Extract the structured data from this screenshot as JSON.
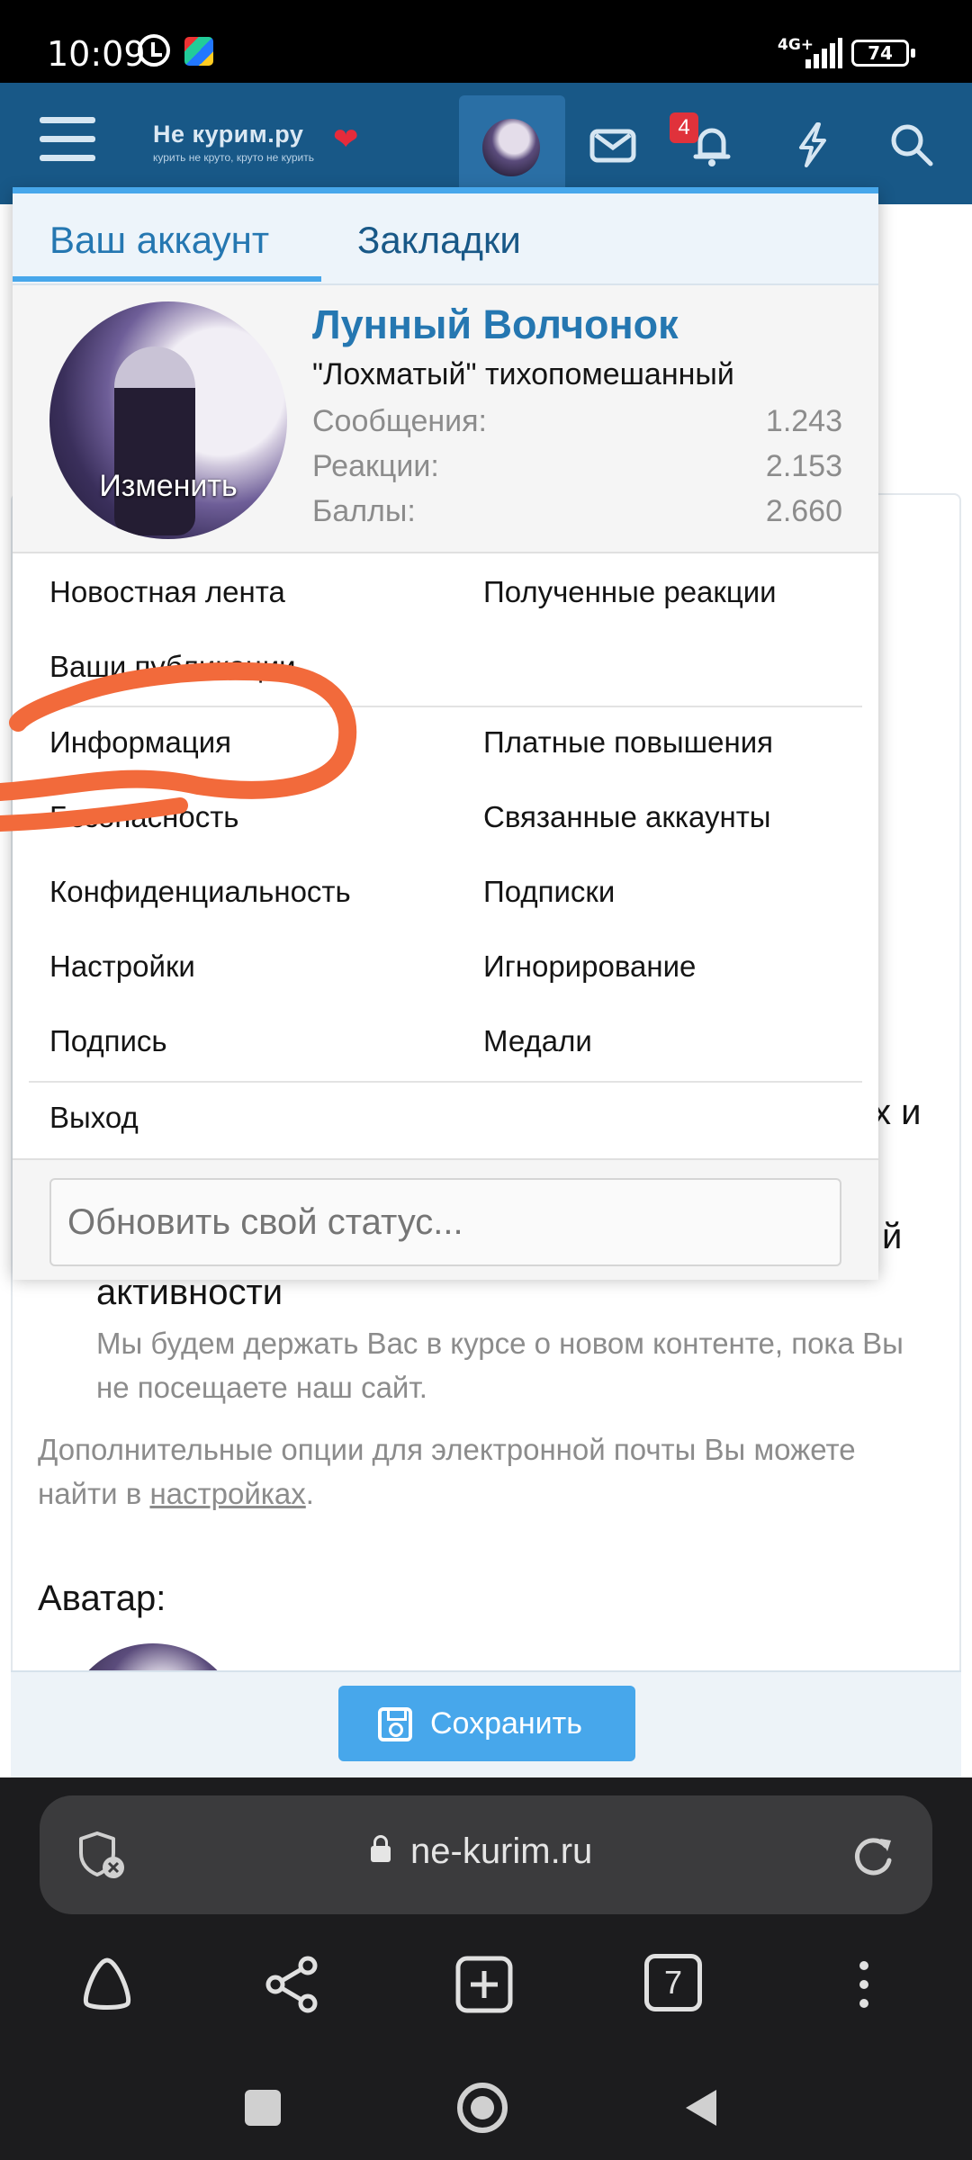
{
  "statusbar": {
    "time": "10:09",
    "network": "4G+",
    "battery": "74"
  },
  "header": {
    "logo_title": "Не курим.ру",
    "logo_tagline": "курить не круто, круто не курить",
    "notification_count": "4"
  },
  "menu": {
    "tabs": [
      "Ваш аккаунт",
      "Закладки"
    ],
    "profile": {
      "name": "Лунный Волчонок",
      "title": "\"Лохматый\" тихопомешанный",
      "avatar_action": "Изменить",
      "stats": [
        {
          "label": "Сообщения:",
          "value": "1.243"
        },
        {
          "label": "Реакции:",
          "value": "2.153"
        },
        {
          "label": "Баллы:",
          "value": "2.660"
        }
      ]
    },
    "items": {
      "news_feed": "Новостная лента",
      "received_reactions": "Полученные реакции",
      "your_publications": "Ваши публикации",
      "information": "Информация",
      "paid_upgrades": "Платные повышения",
      "security": "Безопасность",
      "connected_accounts": "Связанные аккаунты",
      "privacy": "Конфиденциальность",
      "subscriptions": "Подписки",
      "settings": "Настройки",
      "ignoring": "Игнорирование",
      "signature": "Подпись",
      "medals": "Медали",
      "logout": "Выход"
    },
    "status_placeholder": "Обновить свой статус..."
  },
  "page": {
    "fragment_1": "х и",
    "fragment_2": "й",
    "activity_heading": "активности",
    "activity_desc": "Мы будем держать Вас в курсе о новом контенте, пока Вы не посещаете наш сайт.",
    "email_options_prefix": "Дополнительные опции для электронной почты Вы можете найти в ",
    "email_options_link": "настройках",
    "email_options_suffix": ".",
    "avatar_label": "Аватар:",
    "save_button": "Сохранить"
  },
  "browser": {
    "url": "ne-kurim.ru",
    "tab_count": "7"
  },
  "colors": {
    "header_bg": "#185887",
    "accent": "#47a7eb",
    "link": "#2577b1",
    "scribble": "#f26a3b"
  }
}
